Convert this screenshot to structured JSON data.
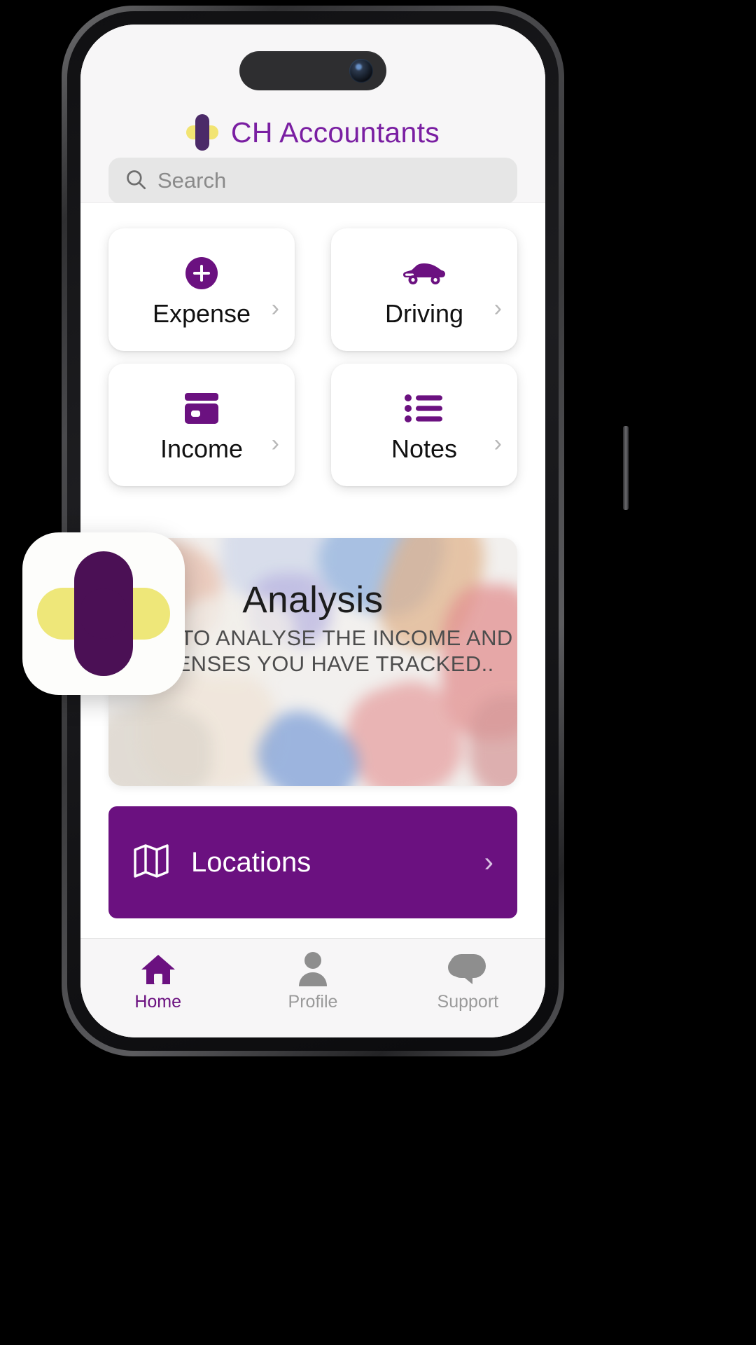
{
  "header": {
    "brand_title": "CH Accountants",
    "logo_icon": "flower-logo-icon",
    "colors": {
      "brand_purple": "#7a1fa2",
      "deep_purple": "#6b1180",
      "yellow": "#f2e472"
    }
  },
  "search": {
    "placeholder": "Search",
    "value": "",
    "icon": "search-icon"
  },
  "tiles": [
    {
      "label": "Expense",
      "icon": "plus-circle-icon",
      "chevron": "›"
    },
    {
      "label": "Driving",
      "icon": "car-icon",
      "chevron": "›"
    },
    {
      "label": "Income",
      "icon": "wallet-card-icon",
      "chevron": "›"
    },
    {
      "label": "Notes",
      "icon": "list-icon",
      "chevron": "›"
    }
  ],
  "banner": {
    "title": "Analysis",
    "subtitle": "HERE TO ANALYSE THE INCOME AND EXPENSES YOU HAVE TRACKED.."
  },
  "locations": {
    "label": "Locations",
    "icon": "map-icon",
    "chevron": "›"
  },
  "tabbar": {
    "items": [
      {
        "label": "Home",
        "icon": "home-icon",
        "active": true
      },
      {
        "label": "Profile",
        "icon": "person-icon",
        "active": false
      },
      {
        "label": "Support",
        "icon": "chat-bubbles-icon",
        "active": false
      }
    ]
  },
  "app_icon": {
    "icon": "app-logo-icon"
  }
}
